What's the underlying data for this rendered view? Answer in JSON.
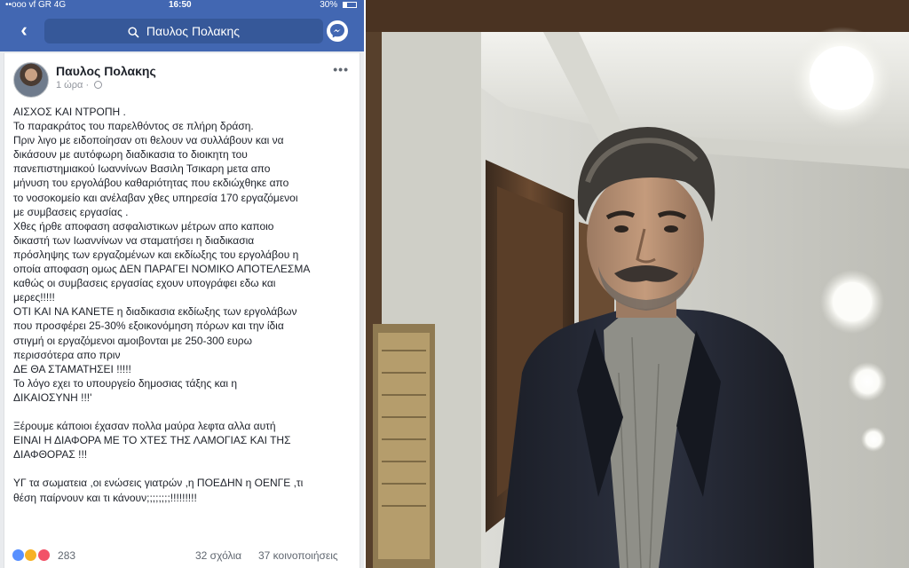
{
  "status_bar": {
    "carrier": "••ooo vf GR  4G",
    "time": "16:50",
    "battery_text": "30%",
    "battery_level": 0.3
  },
  "nav": {
    "search_text": "Παυλος Πολακης"
  },
  "post": {
    "author": "Παυλος Πολακης",
    "time": "1 ώρα",
    "more": "•••",
    "body": "ΑΙΣΧΟΣ ΚΑΙ ΝΤΡΟΠΗ .\nΤο παρακράτος του παρελθόντος σε πλήρη δράση.\nΠριν λιγο με ειδοποίησαν οτι θελουν να συλλάβουν και να\nδικάσουν με αυτόφωρη διαδικασια το διοικητη του\nπανεπιστημιακού Ιωαννίνων Βασιλη Τσικαρη μετα απο\nμήνυση του εργολάβου καθαριότητας που εκδιώχθηκε απο\nτο νοσοκομείο και ανέλαβαν χθες υπηρεσία 170 εργαζόμενοι\nμε συμβασεις εργασίας .\nΧθες ήρθε αποφαση ασφαλιστικων μέτρων απο καποιο\nδικαστή των Ιωαννίνων να σταματήσει η διαδικασια\nπρόσληψης των εργαζομένων και εκδίωξης του εργολάβου η\nοποία αποφαση ομως ΔΕΝ ΠΑΡΑΓΕΙ ΝΟΜΙΚΟ ΑΠΟΤΕΛΕΣΜΑ\nκαθώς οι συμβασεις εργασίας εχουν υπογράφει εδω και\nμερες!!!!!\nΟΤΙ ΚΑΙ ΝΑ ΚΑΝΕΤΕ η διαδικασια εκδίωξης των εργολάβων\nπου προσφέρει 25-30% εξοικονόμηση πόρων και την ίδια\nστιγμή οι εργαζόμενοι αμοιβονται με 250-300 ευρω\nπερισσότερα απο πριν\nΔΕ ΘΑ ΣΤΑΜΑΤΗΣΕΙ !!!!!\nΤο λόγο εχει το υπουργείο δημοσιας τάξης και η\nΔΙΚΑΙΟΣΥΝΗ !!!'\n\nΞέρουμε κάποιοι έχασαν πολλα μαύρα λεφτα αλλα αυτή\nΕΙΝΑΙ Η ΔΙΑΦΟΡΑ ΜΕ ΤΟ ΧΤΕΣ ΤΗΣ ΛΑΜΟΓΙΑΣ ΚΑΙ ΤΗΣ\nΔΙΑΦΘΟΡΑΣ !!!\n\nΥΓ τα σωματεια ,οι ενώσεις γιατρών ,η ΠΟΕΔΗΝ η ΟΕΝΓΕ ,τι\nθέση παίρνουν και τι κάνουν;;;;;;;;!!!!!!!!!",
    "reactions_count": "283",
    "comments": "32 σχόλια",
    "shares": "37 κοινοποιήσεις"
  },
  "colors": {
    "facebook_blue": "#4267b2",
    "search_bg": "#365899",
    "text": "#1d2129",
    "meta": "#90949c"
  },
  "icons": [
    "back-chevron-icon",
    "search-icon",
    "messenger-icon",
    "globe-icon",
    "more-icon",
    "like-reaction-icon",
    "haha-reaction-icon",
    "love-reaction-icon"
  ]
}
